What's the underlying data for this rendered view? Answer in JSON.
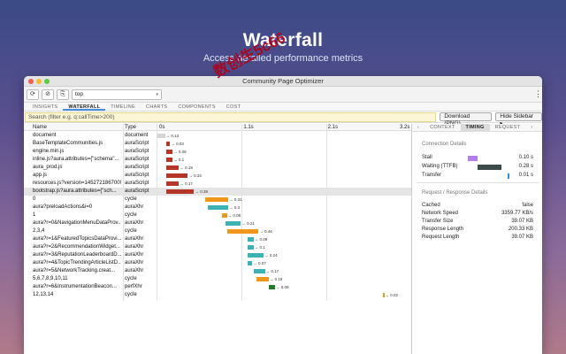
{
  "hero": {
    "title": "Waterfall",
    "subtitle": "Access detailed performance metrics"
  },
  "watermark": "数创生5c66",
  "window": {
    "title": "Community Page Optimizer",
    "traffic": [
      "#ee5f57",
      "#f5bd2e",
      "#5ccb45"
    ]
  },
  "toolbar": {
    "reload_label": "⟳",
    "clear_label": "⊘",
    "page_label": "⎘",
    "frame_value": "top",
    "chevron": "▾",
    "more_label": "⋮"
  },
  "tabs": [
    "INSIGHTS",
    "WATERFALL",
    "TIMELINE",
    "CHARTS",
    "COMPONENTS",
    "COST"
  ],
  "active_tab": "WATERFALL",
  "filter": {
    "placeholder": "Search (filter e.g. q:callTime>200)"
  },
  "buttons": {
    "download": "Download (PNG)",
    "hide_sidebar": "Hide Sidebar ▸"
  },
  "columns": {
    "name": "Name",
    "type": "Type"
  },
  "ticks": [
    "0s",
    "1.1s",
    "2.1s",
    "3.2s"
  ],
  "rows": [
    {
      "name": "document",
      "type": "document",
      "label": "0.13",
      "start": 0.0,
      "end": 0.03,
      "color": "#d5d5d5"
    },
    {
      "name": "BaseTemplateCommunities.js",
      "type": "auraScript",
      "label": "0.03",
      "start": 0.035,
      "end": 0.05,
      "color": "#b5372a"
    },
    {
      "name": "engine.min.js",
      "type": "auraScript",
      "label": "0.09",
      "start": 0.035,
      "end": 0.06,
      "color": "#b5372a"
    },
    {
      "name": "inline.js?aura.attributes={\"schema\"...",
      "type": "auraScript",
      "label": "0.1",
      "start": 0.035,
      "end": 0.06,
      "color": "#b5372a"
    },
    {
      "name": "aura_prod.js",
      "type": "auraScript",
      "label": "0.19",
      "start": 0.035,
      "end": 0.085,
      "color": "#b5372a"
    },
    {
      "name": "app.js",
      "type": "auraScript",
      "label": "0.34",
      "start": 0.035,
      "end": 0.12,
      "color": "#b5372a"
    },
    {
      "name": "resources.js?version=1452721867000",
      "type": "auraScript",
      "label": "0.17",
      "start": 0.035,
      "end": 0.085,
      "color": "#b5372a"
    },
    {
      "name": "bootstrap.js?aura.attributes={\"sch...",
      "type": "auraScript",
      "label": "0.39",
      "start": 0.035,
      "end": 0.145,
      "color": "#b5372a",
      "selected": true
    },
    {
      "name": "0",
      "type": "cycle",
      "label": "0.31",
      "start": 0.19,
      "end": 0.28,
      "color": "#f0961c"
    },
    {
      "name": "aura?preloadActions&i=0",
      "type": "auraXhr",
      "label": "0.3",
      "start": 0.2,
      "end": 0.28,
      "color": "#3bb3b5"
    },
    {
      "name": "1",
      "type": "cycle",
      "label": "0.08",
      "start": 0.255,
      "end": 0.275,
      "color": "#f0961c"
    },
    {
      "name": "aura?r=0&NavigationMenuDataProv...",
      "type": "auraXhr",
      "label": "0.21",
      "start": 0.27,
      "end": 0.33,
      "color": "#3bb3b5"
    },
    {
      "name": "2,3,4",
      "type": "cycle",
      "label": "0.46",
      "start": 0.275,
      "end": 0.4,
      "color": "#f0961c"
    },
    {
      "name": "aura?r=1&FeaturedTopicsDataProvi...",
      "type": "auraXhr",
      "label": "0.09",
      "start": 0.355,
      "end": 0.38,
      "color": "#3bb3b5"
    },
    {
      "name": "aura?r=2&RecommendationWidget...",
      "type": "auraXhr",
      "label": "0.1",
      "start": 0.355,
      "end": 0.38,
      "color": "#3bb3b5"
    },
    {
      "name": "aura?r=3&ReputationLeaderboardD...",
      "type": "auraXhr",
      "label": "0.24",
      "start": 0.355,
      "end": 0.42,
      "color": "#3bb3b5"
    },
    {
      "name": "aura?r=4&TopicTrendingArticleListD...",
      "type": "auraXhr",
      "label": "0.07",
      "start": 0.355,
      "end": 0.375,
      "color": "#3bb3b5"
    },
    {
      "name": "aura?r=5&NetworkTracking.creat...",
      "type": "auraXhr",
      "label": "0.17",
      "start": 0.38,
      "end": 0.425,
      "color": "#3bb3b5"
    },
    {
      "name": "5,6,7,8,9,10,11",
      "type": "cycle",
      "label": "0.18",
      "start": 0.39,
      "end": 0.44,
      "color": "#f0961c"
    },
    {
      "name": "aura?r=6&InstrumentationBeacon...",
      "type": "perfXhr",
      "label": "0.09",
      "start": 0.44,
      "end": 0.465,
      "color": "#1f7a2a"
    },
    {
      "name": "12,13,14",
      "type": "cycle",
      "label": "0.02",
      "start": 0.89,
      "end": 0.895,
      "color": "#f0961c"
    }
  ],
  "side": {
    "tabs": [
      "‹",
      "CONTEXT",
      "TIMING",
      "REQUEST",
      "›"
    ],
    "active_tab": "TIMING",
    "connection_title": "Connection Details",
    "connection": [
      {
        "key": "Stall",
        "value": "0.10 s",
        "color": "#b27ef0",
        "start": 0.0,
        "width": 0.22
      },
      {
        "key": "Waiting (TTFB)",
        "value": "0.28 s",
        "color": "#3c4a4a",
        "start": 0.22,
        "width": 0.58
      },
      {
        "key": "Transfer",
        "value": "0.01 s",
        "color": "#2f8de4",
        "start": 0.94,
        "width": 0.04
      }
    ],
    "response_title": "Request / Response Details",
    "response": [
      {
        "key": "Cached",
        "value": "false"
      },
      {
        "key": "Network Speed",
        "value": "3359.77 KB/s"
      },
      {
        "key": "Transfer Size",
        "value": "39.07 KB"
      },
      {
        "key": "Response Length",
        "value": "200.33 KB"
      },
      {
        "key": "Request Length",
        "value": "39.07 KB"
      }
    ]
  }
}
